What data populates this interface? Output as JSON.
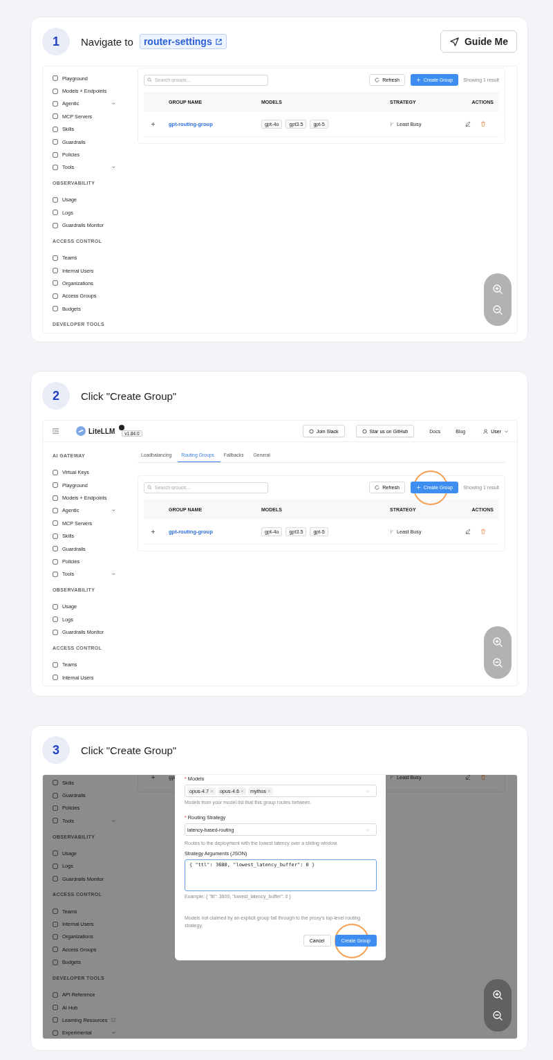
{
  "steps": [
    {
      "number": "1",
      "title": "Navigate to",
      "link": "router-settings",
      "guide_button": "Guide Me",
      "screenshot": {
        "sidebar": [
          {
            "kind": "item",
            "label": "Playground",
            "expandable": false,
            "external": false
          },
          {
            "kind": "item",
            "label": "Models + Endpoints",
            "expandable": false,
            "external": false
          },
          {
            "kind": "item",
            "label": "Agentic",
            "expandable": true,
            "external": false
          },
          {
            "kind": "item",
            "label": "MCP Servers",
            "expandable": false,
            "external": false
          },
          {
            "kind": "item",
            "label": "Skills",
            "expandable": false,
            "external": false
          },
          {
            "kind": "item",
            "label": "Guardrails",
            "expandable": false,
            "external": false
          },
          {
            "kind": "item",
            "label": "Policies",
            "expandable": false,
            "external": false
          },
          {
            "kind": "item",
            "label": "Tools",
            "expandable": true,
            "external": false
          },
          {
            "kind": "section",
            "label": "OBSERVABILITY"
          },
          {
            "kind": "item",
            "label": "Usage",
            "expandable": false,
            "external": false
          },
          {
            "kind": "item",
            "label": "Logs",
            "expandable": false,
            "external": false
          },
          {
            "kind": "item",
            "label": "Guardrails Monitor",
            "expandable": false,
            "external": false
          },
          {
            "kind": "section",
            "label": "ACCESS CONTROL"
          },
          {
            "kind": "item",
            "label": "Teams",
            "expandable": false,
            "external": false
          },
          {
            "kind": "item",
            "label": "Internal Users",
            "expandable": false,
            "external": false
          },
          {
            "kind": "item",
            "label": "Organizations",
            "expandable": false,
            "external": false
          },
          {
            "kind": "item",
            "label": "Access Groups",
            "expandable": false,
            "external": false
          },
          {
            "kind": "item",
            "label": "Budgets",
            "expandable": false,
            "external": false
          },
          {
            "kind": "section",
            "label": "DEVELOPER TOOLS"
          }
        ],
        "table_card": {
          "search_placeholder": "Search groups...",
          "refresh_button": "Refresh",
          "create_button": {
            "label": "Create Group",
            "highlighted": false
          },
          "result_count": "Showing 1 result",
          "columns": [
            "GROUP NAME",
            "MODELS",
            "STRATEGY",
            "ACTIONS"
          ],
          "rows": [
            {
              "name": "gpt-routing-group",
              "models": [
                "gpt-4o",
                "gpt3.5",
                "gpt-5"
              ],
              "strategy": "Least Busy"
            }
          ]
        }
      }
    },
    {
      "number": "2",
      "title": "Click \"Create Group\"",
      "screenshot": {
        "topbar": {
          "logo": "LiteLLM",
          "version": "v1.84.0",
          "buttons": [
            "Join Slack",
            "Star us on GitHub"
          ],
          "links": [
            "Docs",
            "Blog"
          ],
          "user": "User"
        },
        "sidebar": [
          {
            "kind": "section",
            "label": "AI GATEWAY"
          },
          {
            "kind": "item",
            "label": "Virtual Keys",
            "expandable": false,
            "external": false
          },
          {
            "kind": "item",
            "label": "Playground",
            "expandable": false,
            "external": false
          },
          {
            "kind": "item",
            "label": "Models + Endpoints",
            "expandable": false,
            "external": false
          },
          {
            "kind": "item",
            "label": "Agentic",
            "expandable": true,
            "external": false
          },
          {
            "kind": "item",
            "label": "MCP Servers",
            "expandable": false,
            "external": false
          },
          {
            "kind": "item",
            "label": "Skills",
            "expandable": false,
            "external": false
          },
          {
            "kind": "item",
            "label": "Guardrails",
            "expandable": false,
            "external": false
          },
          {
            "kind": "item",
            "label": "Policies",
            "expandable": false,
            "external": false
          },
          {
            "kind": "item",
            "label": "Tools",
            "expandable": true,
            "external": false
          },
          {
            "kind": "section",
            "label": "OBSERVABILITY"
          },
          {
            "kind": "item",
            "label": "Usage",
            "expandable": false,
            "external": false
          },
          {
            "kind": "item",
            "label": "Logs",
            "expandable": false,
            "external": false
          },
          {
            "kind": "item",
            "label": "Guardrails Monitor",
            "expandable": false,
            "external": false
          },
          {
            "kind": "section",
            "label": "ACCESS CONTROL"
          },
          {
            "kind": "item",
            "label": "Teams",
            "expandable": false,
            "external": false
          },
          {
            "kind": "item",
            "label": "Internal Users",
            "expandable": false,
            "external": false
          }
        ],
        "tabs": [
          {
            "label": "Loadbalancing",
            "selected": false
          },
          {
            "label": "Routing Groups",
            "selected": true
          },
          {
            "label": "Fallbacks",
            "selected": false
          },
          {
            "label": "General",
            "selected": false
          }
        ],
        "table_card": {
          "search_placeholder": "Search groups...",
          "refresh_button": "Refresh",
          "create_button": {
            "label": "Create Group",
            "highlighted": true
          },
          "result_count": "Showing 1 result",
          "columns": [
            "GROUP NAME",
            "MODELS",
            "STRATEGY",
            "ACTIONS"
          ],
          "rows": [
            {
              "name": "gpt-routing-group",
              "models": [
                "gpt-4o",
                "gpt3.5",
                "gpt-5"
              ],
              "strategy": "Least Busy"
            }
          ]
        }
      }
    },
    {
      "number": "3",
      "title": "Click \"Create Group\"",
      "screenshot": {
        "sidebar": [
          {
            "kind": "item",
            "label": "Skills",
            "expandable": false,
            "external": false
          },
          {
            "kind": "item",
            "label": "Guardrails",
            "expandable": false,
            "external": false
          },
          {
            "kind": "item",
            "label": "Policies",
            "expandable": false,
            "external": false
          },
          {
            "kind": "item",
            "label": "Tools",
            "expandable": true,
            "external": false
          },
          {
            "kind": "section",
            "label": "OBSERVABILITY"
          },
          {
            "kind": "item",
            "label": "Usage",
            "expandable": false,
            "external": false
          },
          {
            "kind": "item",
            "label": "Logs",
            "expandable": false,
            "external": false
          },
          {
            "kind": "item",
            "label": "Guardrails Monitor",
            "expandable": false,
            "external": false
          },
          {
            "kind": "section",
            "label": "ACCESS CONTROL"
          },
          {
            "kind": "item",
            "label": "Teams",
            "expandable": false,
            "external": false
          },
          {
            "kind": "item",
            "label": "Internal Users",
            "expandable": false,
            "external": false
          },
          {
            "kind": "item",
            "label": "Organizations",
            "expandable": false,
            "external": false
          },
          {
            "kind": "item",
            "label": "Access Groups",
            "expandable": false,
            "external": false
          },
          {
            "kind": "item",
            "label": "Budgets",
            "expandable": false,
            "external": false
          },
          {
            "kind": "section",
            "label": "DEVELOPER TOOLS"
          },
          {
            "kind": "item",
            "label": "API Reference",
            "expandable": false,
            "external": false
          },
          {
            "kind": "item",
            "label": "AI Hub",
            "expandable": false,
            "external": false
          },
          {
            "kind": "item",
            "label": "Learning Resources",
            "expandable": false,
            "external": true
          },
          {
            "kind": "item",
            "label": "Experimental",
            "expandable": true,
            "external": false
          }
        ],
        "background_row": {
          "name": "gp",
          "strategy": "Least Busy"
        },
        "modal": {
          "models_field": {
            "label": "Models",
            "required_mark": "*",
            "tags": [
              "opus-4.7",
              "opus-4.6",
              "mythos"
            ],
            "hint": "Models from your model list that this group routes between."
          },
          "strategy_field": {
            "label": "Routing Strategy",
            "required_mark": "*",
            "value": "latency-based-routing",
            "hint": "Routes to the deployment with the lowest latency over a sliding window."
          },
          "arguments_field": {
            "label": "Strategy Arguments (JSON)",
            "value": "{ \"ttl\": 3600, \"lowest_latency_buffer\": 0 }",
            "hint": "Example: { \"ttl\": 3600, \"lowest_latency_buffer\": 0 }"
          },
          "note": "Models not claimed by an explicit group fall through to the proxy's top-level routing strategy.",
          "cancel_button": "Cancel",
          "create_button": {
            "label": "Create Group",
            "highlighted": true
          }
        }
      }
    }
  ]
}
